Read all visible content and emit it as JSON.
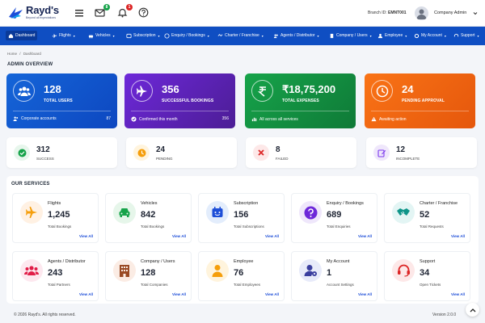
{
  "brand": {
    "name": "Rayd's",
    "tagline": "Beyond all expectations"
  },
  "header": {
    "notifications": {
      "mail_count": "8",
      "bell_count": "1"
    },
    "branch_label": "Branch ID:",
    "branch_id": "EMNT001",
    "user_name": "Company Admin"
  },
  "nav": {
    "items": [
      {
        "label": "Dashboard",
        "icon": "home-icon"
      },
      {
        "label": "Flights",
        "icon": "plane-icon"
      },
      {
        "label": "Vehicles",
        "icon": "car-icon"
      },
      {
        "label": "Subscription",
        "icon": "subscription-icon"
      },
      {
        "label": "Enquiry / Bookings",
        "icon": "help-icon"
      },
      {
        "label": "Charter / Franchise",
        "icon": "handshake-icon"
      },
      {
        "label": "Agents / Distributor",
        "icon": "users-icon"
      },
      {
        "label": "Company / Users",
        "icon": "building-icon"
      },
      {
        "label": "Employee",
        "icon": "employee-icon"
      },
      {
        "label": "My Account",
        "icon": "gear-icon"
      },
      {
        "label": "Support",
        "icon": "headset-icon"
      }
    ]
  },
  "breadcrumb": {
    "home": "Home",
    "sep": "/",
    "current": "Dashboard"
  },
  "overview": {
    "title": "ADMIN OVERVIEW",
    "cards": [
      {
        "value": "128",
        "label": "TOTAL USERS",
        "footer": "Corporate accounts",
        "footer_count": "87",
        "color_from": "#1565d8",
        "color_to": "#0d47c0"
      },
      {
        "value": "356",
        "label": "SUCCESSFUL BOOKINGS",
        "footer": "Confirmed this month",
        "footer_count": "356",
        "color_from": "#6d28d9",
        "color_to": "#4c1d95"
      },
      {
        "value": "₹18,75,200",
        "label": "TOTAL EXPENSES",
        "footer": "All across all services",
        "footer_count": "",
        "color_from": "#16a34a",
        "color_to": "#0f7a37"
      },
      {
        "value": "24",
        "label": "PENDING APPROVAL",
        "footer": "Awaiting action",
        "footer_count": "",
        "color_from": "#f97316",
        "color_to": "#e5570c"
      }
    ],
    "status": [
      {
        "value": "312",
        "label": "SUCCESS",
        "icon": "check-circle-icon",
        "bg": "#e7f6ec",
        "fg": "#16a34a"
      },
      {
        "value": "24",
        "label": "PENDING",
        "icon": "clock-icon",
        "bg": "#fff4dd",
        "fg": "#f59e0b"
      },
      {
        "value": "8",
        "label": "FAILED",
        "icon": "x-icon",
        "bg": "#fde8e8",
        "fg": "#dc2626"
      },
      {
        "value": "12",
        "label": "INCOMPLETE",
        "icon": "edit-icon",
        "bg": "#efe7fb",
        "fg": "#7c3aed"
      }
    ]
  },
  "services": {
    "title": "OUR SERVICES",
    "view_all": "View All",
    "items": [
      {
        "name": "Flights",
        "value": "1,245",
        "sub": "Total Bookings",
        "icon": "plane-icon",
        "bg": "#fff1e3",
        "fg": "#f59e0b"
      },
      {
        "name": "Vehicles",
        "value": "842",
        "sub": "Total Bookings",
        "icon": "car-icon",
        "bg": "#e6f6ea",
        "fg": "#16a34a"
      },
      {
        "name": "Subscription",
        "value": "156",
        "sub": "Total Subscriptions",
        "icon": "subscription-icon",
        "bg": "#e3edfc",
        "fg": "#1d4ed8"
      },
      {
        "name": "Enquiry / Bookings",
        "value": "689",
        "sub": "Total Enquiries",
        "icon": "question-icon",
        "bg": "#efe7fb",
        "fg": "#6d28d9"
      },
      {
        "name": "Charter / Franchise",
        "value": "52",
        "sub": "Total Requests",
        "icon": "handshake-icon",
        "bg": "#e3f5f4",
        "fg": "#0d9488"
      },
      {
        "name": "Agents / Distributor",
        "value": "243",
        "sub": "Total Partners",
        "icon": "users-icon",
        "bg": "#fde8ef",
        "fg": "#e11d48"
      },
      {
        "name": "Company / Users",
        "value": "128",
        "sub": "Total Companies",
        "icon": "building-icon",
        "bg": "#fbece4",
        "fg": "#9a4a24"
      },
      {
        "name": "Employee",
        "value": "76",
        "sub": "Total Employees",
        "icon": "employee-icon",
        "bg": "#fff4dd",
        "fg": "#f59e0b"
      },
      {
        "name": "My Account",
        "value": "1",
        "sub": "Account Settings",
        "icon": "account-gear-icon",
        "bg": "#e8ebfa",
        "fg": "#3b3f9f"
      },
      {
        "name": "Support",
        "value": "34",
        "sub": "Open Tickets",
        "icon": "headset-icon",
        "bg": "#fde8e8",
        "fg": "#dc2626"
      }
    ]
  },
  "footer": {
    "copyright": "© 2026 Rayd's. All rights reserved.",
    "version": "Version 2.0.0"
  }
}
